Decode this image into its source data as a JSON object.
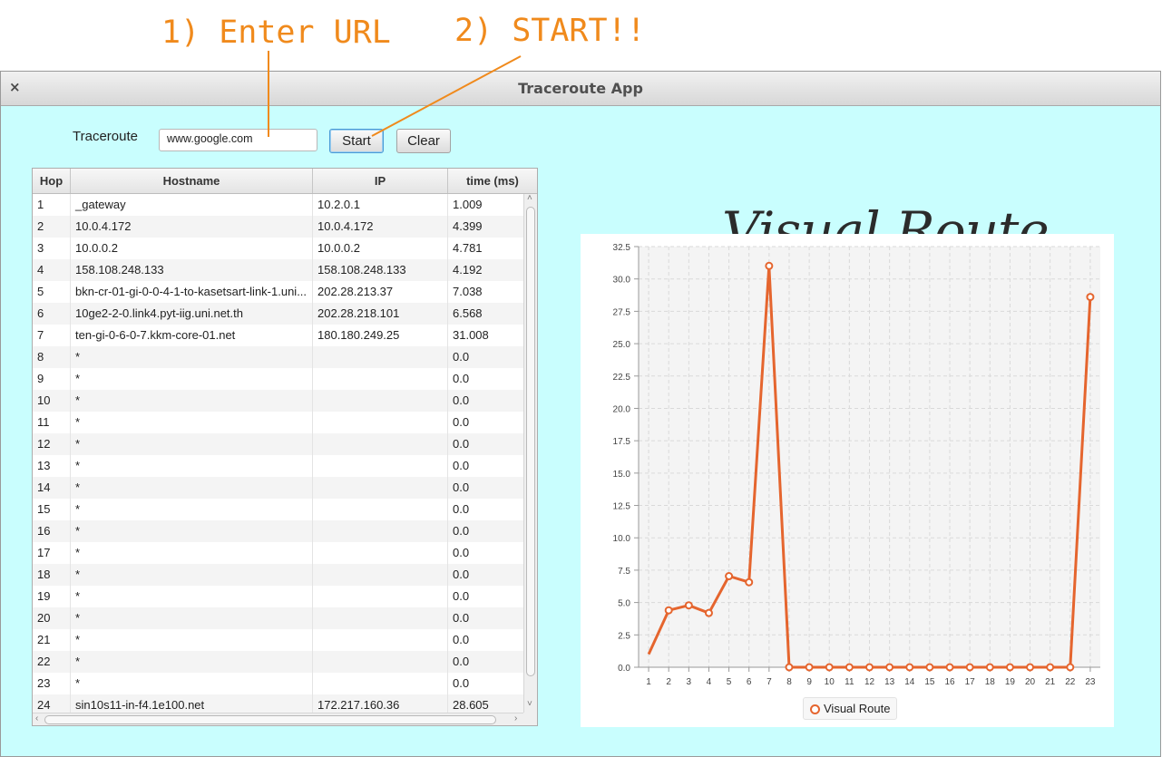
{
  "annotations": {
    "step1": "1) Enter URL",
    "step2": "2) START!!"
  },
  "window": {
    "title": "Traceroute App",
    "close_glyph": "×"
  },
  "form": {
    "label": "Traceroute",
    "url_value": "www.google.com",
    "start_label": "Start",
    "clear_label": "Clear"
  },
  "table": {
    "columns": [
      "Hop",
      "Hostname",
      "IP",
      "time (ms)"
    ],
    "rows": [
      [
        "1",
        "_gateway",
        "10.2.0.1",
        "1.009"
      ],
      [
        "2",
        "10.0.4.172",
        "10.0.4.172",
        "4.399"
      ],
      [
        "3",
        "10.0.0.2",
        "10.0.0.2",
        "4.781"
      ],
      [
        "4",
        "158.108.248.133",
        "158.108.248.133",
        "4.192"
      ],
      [
        "5",
        "bkn-cr-01-gi-0-0-4-1-to-kasetsart-link-1.uni...",
        "202.28.213.37",
        "7.038"
      ],
      [
        "6",
        "10ge2-2-0.link4.pyt-iig.uni.net.th",
        "202.28.218.101",
        "6.568"
      ],
      [
        "7",
        "ten-gi-0-6-0-7.kkm-core-01.net",
        "180.180.249.25",
        "31.008"
      ],
      [
        "8",
        "*",
        "",
        "0.0"
      ],
      [
        "9",
        "*",
        "",
        "0.0"
      ],
      [
        "10",
        "*",
        "",
        "0.0"
      ],
      [
        "11",
        "*",
        "",
        "0.0"
      ],
      [
        "12",
        "*",
        "",
        "0.0"
      ],
      [
        "13",
        "*",
        "",
        "0.0"
      ],
      [
        "14",
        "*",
        "",
        "0.0"
      ],
      [
        "15",
        "*",
        "",
        "0.0"
      ],
      [
        "16",
        "*",
        "",
        "0.0"
      ],
      [
        "17",
        "*",
        "",
        "0.0"
      ],
      [
        "18",
        "*",
        "",
        "0.0"
      ],
      [
        "19",
        "*",
        "",
        "0.0"
      ],
      [
        "20",
        "*",
        "",
        "0.0"
      ],
      [
        "21",
        "*",
        "",
        "0.0"
      ],
      [
        "22",
        "*",
        "",
        "0.0"
      ],
      [
        "23",
        "*",
        "",
        "0.0"
      ],
      [
        "24",
        "sin10s11-in-f4.1e100.net",
        "172.217.160.36",
        "28.605"
      ]
    ]
  },
  "panel_heading": "Visual Route",
  "colors": {
    "accent_orange": "#f08a1c",
    "series": "#e5652e",
    "window_bg": "#c9fefe"
  },
  "chart_data": {
    "type": "line",
    "x": [
      1,
      2,
      3,
      4,
      5,
      6,
      7,
      8,
      9,
      10,
      11,
      12,
      13,
      14,
      15,
      16,
      17,
      18,
      19,
      20,
      21,
      22,
      23
    ],
    "series": [
      {
        "name": "Visual Route",
        "values": [
          1.009,
          4.399,
          4.781,
          4.192,
          7.038,
          6.568,
          31.008,
          0.0,
          0.0,
          0.0,
          0.0,
          0.0,
          0.0,
          0.0,
          0.0,
          0.0,
          0.0,
          0.0,
          0.0,
          0.0,
          0.0,
          0.0,
          28.605
        ]
      }
    ],
    "xticks": [
      "1",
      "2",
      "3",
      "4",
      "5",
      "6",
      "7",
      "8",
      "9",
      "10",
      "11",
      "12",
      "13",
      "14",
      "15",
      "16",
      "17",
      "18",
      "19",
      "20",
      "21",
      "22",
      "23"
    ],
    "yticks": [
      "0.0",
      "2.5",
      "5.0",
      "7.5",
      "10.0",
      "12.5",
      "15.0",
      "17.5",
      "20.0",
      "22.5",
      "25.0",
      "27.5",
      "30.0",
      "32.5"
    ],
    "ylim": [
      0,
      32.5
    ],
    "grid": true,
    "legend_position": "bottom",
    "legend": [
      "Visual Route"
    ]
  }
}
